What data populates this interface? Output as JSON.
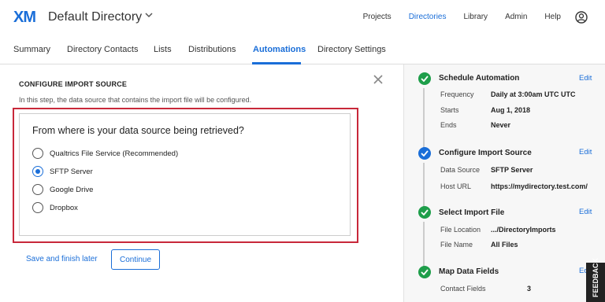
{
  "header": {
    "logo": "XM",
    "directory_name": "Default Directory",
    "nav": [
      "Projects",
      "Directories",
      "Library",
      "Admin",
      "Help"
    ],
    "active_nav": "Directories",
    "icons": {
      "caret": "chevron-down-icon",
      "profile": "user-avatar-icon"
    }
  },
  "tabs": {
    "items": [
      "Summary",
      "Directory Contacts",
      "Lists",
      "Distributions",
      "Automations",
      "Directory Settings"
    ],
    "active": "Automations"
  },
  "main": {
    "section_title": "CONFIGURE IMPORT SOURCE",
    "description": "In this step, the data source that contains the import file will be configured.",
    "question": "From where is your data source being retrieved?",
    "options": [
      "Qualtrics File Service (Recommended)",
      "SFTP Server",
      "Google Drive",
      "Dropbox"
    ],
    "selected_option": "SFTP Server",
    "save_later": "Save and finish later",
    "continue": "Continue"
  },
  "sidebar": {
    "edit_label": "Edit",
    "steps": [
      {
        "title": "Schedule Automation",
        "status": "complete",
        "fields": [
          {
            "key": "Frequency",
            "value": "Daily at 3:00am UTC UTC"
          },
          {
            "key": "Starts",
            "value": "Aug 1, 2018"
          },
          {
            "key": "Ends",
            "value": "Never"
          }
        ]
      },
      {
        "title": "Configure Import Source",
        "status": "current",
        "fields": [
          {
            "key": "Data Source",
            "value": "SFTP Server"
          },
          {
            "key": "Host URL",
            "value": "https://mydirectory.test.com/"
          }
        ]
      },
      {
        "title": "Select Import File",
        "status": "complete",
        "fields": [
          {
            "key": "File Location",
            "value": ".../DirectoryImports"
          },
          {
            "key": "File Name",
            "value": "All Files"
          }
        ]
      },
      {
        "title": "Map Data Fields",
        "status": "complete",
        "fields": [
          {
            "key": "Contact Fields",
            "value": "3"
          }
        ]
      }
    ]
  },
  "feedback_tab": "FEEDBACK",
  "colors": {
    "accent": "#1a6ed8",
    "success": "#1e9e4a",
    "highlight": "#c8283a"
  }
}
